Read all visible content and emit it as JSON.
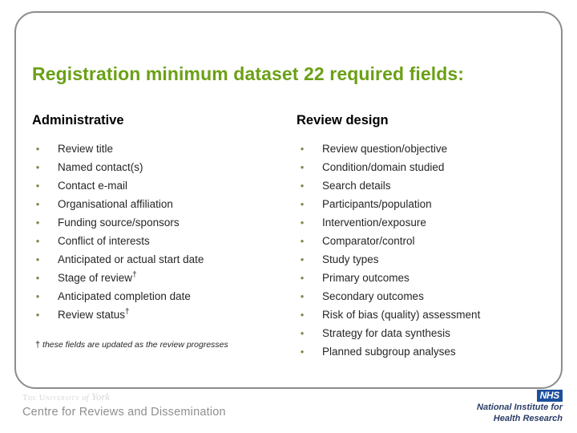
{
  "slide": {
    "title": "Registration minimum dataset 22 required fields:",
    "title_color": "#6ba016",
    "frame_color": "#8c8c8c"
  },
  "columns": [
    {
      "heading": "Administrative",
      "bullet_glyph": "•",
      "bullet_color": "#7d8c4e",
      "items": [
        {
          "label": "Review title",
          "dagger": false
        },
        {
          "label": "Named contact(s)",
          "dagger": false
        },
        {
          "label": "Contact e-mail",
          "dagger": false
        },
        {
          "label": "Organisational affiliation",
          "dagger": false
        },
        {
          "label": "Funding source/sponsors",
          "dagger": false
        },
        {
          "label": "Conflict of interests",
          "dagger": false
        },
        {
          "label": "Anticipated or actual start date",
          "dagger": false
        },
        {
          "label": "Stage of review",
          "dagger": true
        },
        {
          "label": "Anticipated completion date",
          "dagger": false
        },
        {
          "label": "Review status",
          "dagger": true
        }
      ],
      "footnote_symbol": "†",
      "footnote": "these fields are updated as the review progresses"
    },
    {
      "heading": "Review design",
      "bullet_glyph": "•",
      "bullet_color": "#7d8c4e",
      "items": [
        {
          "label": "Review question/objective",
          "dagger": false
        },
        {
          "label": "Condition/domain studied",
          "dagger": false
        },
        {
          "label": "Search details",
          "dagger": false
        },
        {
          "label": "Participants/population",
          "dagger": false
        },
        {
          "label": "Intervention/exposure",
          "dagger": false
        },
        {
          "label": "Comparator/control",
          "dagger": false
        },
        {
          "label": "Study types",
          "dagger": false
        },
        {
          "label": "Primary outcomes",
          "dagger": false
        },
        {
          "label": "Secondary outcomes",
          "dagger": false
        },
        {
          "label": "Risk of bias (quality) assessment",
          "dagger": false
        },
        {
          "label": "Strategy for data synthesis",
          "dagger": false
        },
        {
          "label": "Planned subgroup analyses",
          "dagger": false
        }
      ]
    }
  ],
  "footer": {
    "university_prefix": "The University",
    "university_of": "of",
    "university_place": "York",
    "centre_name": "Centre for Reviews and Dissemination",
    "nhs_label": "NHS",
    "nhs_color": "#1c4f9c",
    "nihr_line1": "National Institute for",
    "nihr_line2": "Health Research",
    "nihr_color": "#2b3d66"
  }
}
